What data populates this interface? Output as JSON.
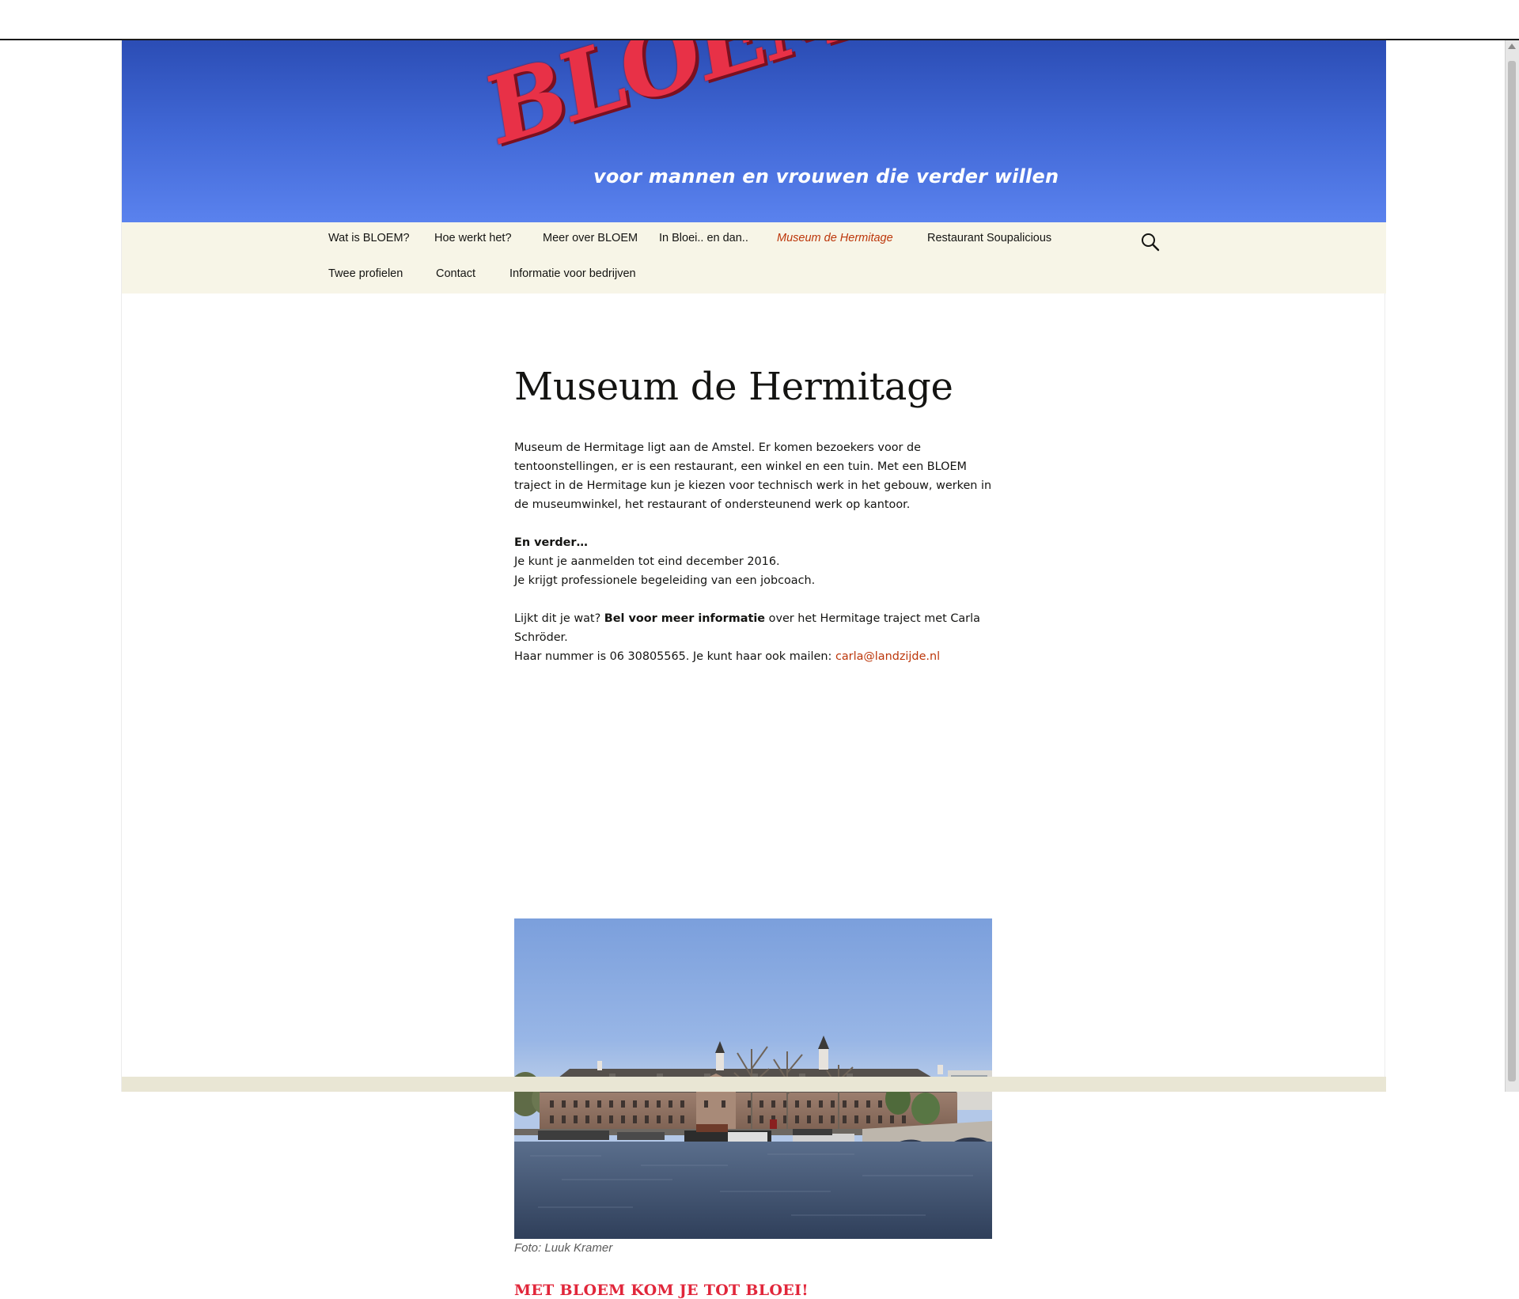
{
  "header": {
    "logo_text": "BLOEM!",
    "tagline": "voor mannen en vrouwen die verder willen"
  },
  "nav": {
    "items": [
      {
        "label": "Wat is BLOEM?"
      },
      {
        "label": "Hoe werkt het?"
      },
      {
        "label": "Meer over BLOEM"
      },
      {
        "label": "In Bloei.. en dan.."
      },
      {
        "label": "Museum de Hermitage"
      },
      {
        "label": "Restaurant Soupalicious"
      },
      {
        "label": "Twee profielen"
      },
      {
        "label": "Contact"
      },
      {
        "label": "Informatie voor bedrijven"
      }
    ],
    "active": "Museum de Hermitage",
    "search_icon": "search-icon"
  },
  "page": {
    "title": "Museum de Hermitage",
    "intro": "Museum de Hermitage ligt aan de Amstel. Er komen bezoekers voor de tentoonstellingen, er is een restaurant, een winkel en een tuin. Met een BLOEM traject in de Hermitage kun je kiezen voor technisch werk in het gebouw, werken in de museumwinkel, het restaurant of ondersteunend werk op kantoor.",
    "more_heading": "En verder…",
    "more_line1": "Je kunt je aanmelden tot eind december 2016.",
    "more_line2": "Je krijgt professionele begeleiding van een jobcoach.",
    "contact_pre": "Lijkt dit je wat? ",
    "contact_bold": "Bel voor meer informatie",
    "contact_post": " over het Hermitage traject met Carla Schröder.",
    "contact_line2": "Haar nummer is 06 30805565. Je kunt haar ook mailen: ",
    "email": "carla@landzijde.nl",
    "photo_caption": "Foto: Luuk Kramer",
    "slogan": "MET BLOEM KOM JE TOT BLOEI!"
  },
  "colors": {
    "header_top": "#2b4db5",
    "header_bottom": "#5a82ee",
    "nav_bg": "#f7f5e7",
    "active_link": "#bc360a",
    "slogan": "#e1263a",
    "logo": "#e83147"
  }
}
